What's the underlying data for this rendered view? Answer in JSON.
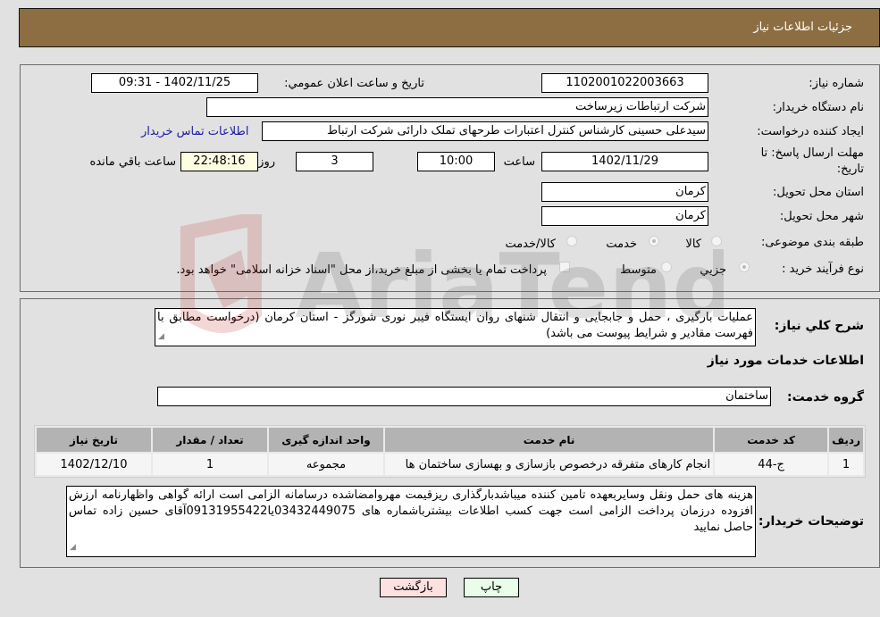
{
  "header": {
    "title": "جزئیات اطلاعات نیاز"
  },
  "details": {
    "need_number": {
      "label": "شماره نیاز:",
      "value": "1102001022003663"
    },
    "announce_datetime": {
      "label": "تاریخ و ساعت اعلان عمومي:",
      "value": "1402/11/25 - 09:31"
    },
    "buyer_org": {
      "label": "نام دستگاه خریدار:",
      "value": "شرکت ارتباطات زیرساخت"
    },
    "requester": {
      "label": "ایجاد کننده درخواست:",
      "value": "سیدعلی حسینی کارشناس کنترل اعتبارات طرحهای تملک دارائی شرکت ارتباط",
      "contact_link": "اطلاعات تماس خریدار"
    },
    "deadline": {
      "label_line1": "مهلت ارسال پاسخ: تا",
      "label_line2": "تاریخ:",
      "date": "1402/11/29",
      "time_label": "ساعت",
      "time": "10:00",
      "days": "3",
      "days_label": "روز و",
      "remaining": "22:48:16",
      "remaining_label": "ساعت باقي مانده"
    },
    "province": {
      "label": "استان محل تحویل:",
      "value": "کرمان"
    },
    "city": {
      "label": "شهر محل تحویل:",
      "value": "کرمان"
    },
    "category": {
      "label": "طبقه بندی موضوعی:",
      "options": [
        "کالا",
        "خدمت",
        "کالا/خدمت"
      ],
      "selected": "خدمت"
    },
    "purchase_type": {
      "label": "نوع فرآیند خرید :",
      "options": [
        "جزيي",
        "متوسط"
      ],
      "selected": "جزيي",
      "treasury_note": "پرداخت تمام یا بخشی از مبلغ خرید،از محل \"اسناد خزانه اسلامی\" خواهد بود."
    }
  },
  "description": {
    "label": "شرح كلي نياز:",
    "value": "عملیات بارگیری ، حمل و جابجایی و انتقال شنهای روان ایستگاه فیبر نوری شورگز - استان کرمان (درخواست مطابق با فهرست مقادیر و شرایط پیوست می باشد)"
  },
  "services": {
    "section_title": "اطلاعات خدمات مورد نیاز",
    "group_label": "گروه خدمت:",
    "group_value": "ساختمان",
    "columns": [
      "ردیف",
      "کد خدمت",
      "نام خدمت",
      "واحد اندازه گیری",
      "تعداد / مقدار",
      "تاریخ نیاز"
    ],
    "rows": [
      {
        "row": "1",
        "code": "ج-44",
        "name": "انجام کارهای متفرقه درخصوص بازسازی و بهسازی ساختمان ها",
        "unit": "مجموعه",
        "qty": "1",
        "date": "1402/12/10"
      }
    ]
  },
  "buyer_notes": {
    "label": "توضیحات خریدار:",
    "value": "هزینه های حمل ونقل وسایربعهده تامین کننده میباشدبارگذاری ریزقیمت مهروامضاشده درسامانه الزامی است ارائه گواهی واظهارنامه ارزش افزوده درزمان پرداخت الزامی است جهت کسب اطلاعات بیشترباشماره های 03432449075یا09131955422آقای حسین زاده تماس حاصل نمایید"
  },
  "buttons": {
    "print": "چاپ",
    "back": "بازگشت"
  },
  "colors": {
    "header_bg": "#8d6d42",
    "print_bg": "#e9fde9",
    "back_bg": "#fde0e0",
    "link": "#1a1aa6"
  }
}
